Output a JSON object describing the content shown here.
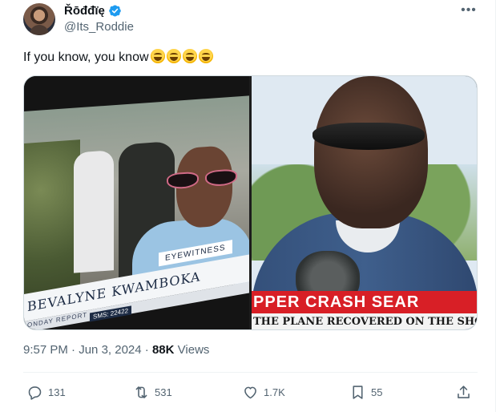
{
  "author": {
    "display_name": "Řōđđïę",
    "handle": "@Its_Roddie",
    "verified": true
  },
  "more_icon": "more-horizontal-icon",
  "tweet_text": "If you know, you know",
  "emoji_count": 4,
  "media": {
    "left": {
      "name_caption": "BEVALYNE KWAMBOKA",
      "role_caption": "EYEWITNESS",
      "show_caption": "ONDAY REPORT",
      "sms_caption": "SMS: 22422"
    },
    "right": {
      "ticker_headline": "PPER CRASH SEAR",
      "ticker_sub": "THE PLANE RECOVERED ON THE SHORES O"
    }
  },
  "meta": {
    "time": "9:57 PM",
    "separator": "·",
    "date": "Jun 3, 2024",
    "views_count": "88K",
    "views_label": "Views"
  },
  "actions": {
    "replies": "131",
    "reposts": "531",
    "likes": "1.7K",
    "bookmarks": "55"
  },
  "colors": {
    "text_primary": "#0f1419",
    "text_secondary": "#536471",
    "verified_blue": "#1d9bf0",
    "divider": "#eff3f4",
    "ticker_red": "#d81f26"
  }
}
